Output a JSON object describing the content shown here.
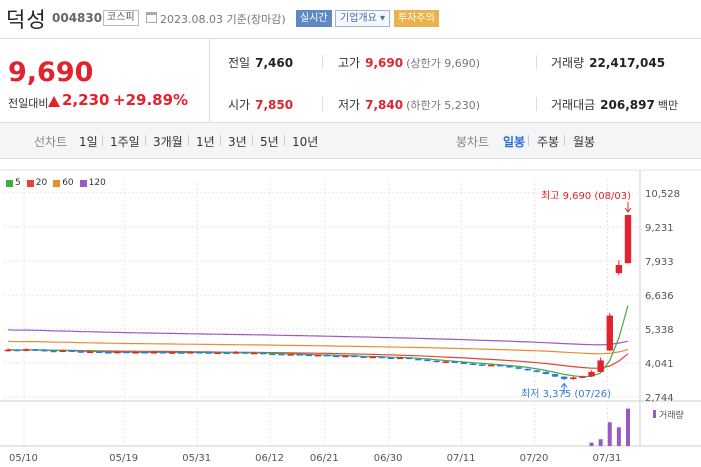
{
  "header": {
    "name": "덕성",
    "code": "004830",
    "market": "코스피",
    "date_text": "2023.08.03 기준(장마감)",
    "btn_realtime": "실시간",
    "btn_company": "기업개요",
    "btn_warning": "투자주의"
  },
  "quote": {
    "price": "9,690",
    "change_label": "전일대비",
    "change_value": "2,230",
    "change_percent": "+29.89%",
    "prev_close_label": "전일",
    "prev_close": "7,460",
    "open_label": "시가",
    "open": "7,850",
    "high_label": "고가",
    "high": "9,690",
    "upper_limit_text": "(상한가 9,690)",
    "low_label": "저가",
    "low": "7,840",
    "lower_limit_text": "(하한가 5,230)",
    "volume_label": "거래량",
    "volume": "22,417,045",
    "amount_label": "거래대금",
    "amount": "206,897",
    "amount_unit": "백만"
  },
  "tabs": {
    "line_label": "선차트",
    "periods": [
      "1일",
      "1주일",
      "3개월",
      "1년",
      "3년",
      "5년",
      "10년"
    ],
    "candle_label": "봉차트",
    "candle_options": [
      "일봉",
      "주봉",
      "월봉"
    ],
    "active_candle": "일봉"
  },
  "legend": [
    {
      "label": "5",
      "color": "#3fae3f"
    },
    {
      "label": "20",
      "color": "#e2443a"
    },
    {
      "label": "60",
      "color": "#ef8a2b"
    },
    {
      "label": "120",
      "color": "#9b59c4"
    }
  ],
  "chart_data": {
    "type": "candlestick",
    "y_ticks": [
      "10,528",
      "9,231",
      "7,933",
      "6,636",
      "5,338",
      "4,041",
      "2,744"
    ],
    "ylim": [
      2744,
      10528
    ],
    "x_ticks": [
      "05/10",
      "05/19",
      "05/31",
      "06/12",
      "06/21",
      "06/30",
      "07/11",
      "07/20",
      "07/31"
    ],
    "high_annotation": "최고 9,690 (08/03)",
    "low_annotation": "최저 3,375 (07/26)",
    "volume_label": "거래량",
    "colors": {
      "up": "#e0232e",
      "down": "#2f7ce0",
      "grid": "#e6e6e6"
    },
    "candles": [
      [
        4510,
        4550,
        4600,
        4470
      ],
      [
        4550,
        4520,
        4580,
        4480
      ],
      [
        4520,
        4560,
        4610,
        4490
      ],
      [
        4560,
        4540,
        4590,
        4500
      ],
      [
        4540,
        4510,
        4570,
        4480
      ],
      [
        4510,
        4480,
        4550,
        4450
      ],
      [
        4480,
        4520,
        4560,
        4460
      ],
      [
        4520,
        4490,
        4540,
        4460
      ],
      [
        4490,
        4450,
        4510,
        4420
      ],
      [
        4450,
        4480,
        4520,
        4430
      ],
      [
        4480,
        4460,
        4500,
        4430
      ],
      [
        4460,
        4430,
        4480,
        4400
      ],
      [
        4430,
        4470,
        4500,
        4410
      ],
      [
        4470,
        4440,
        4490,
        4420
      ],
      [
        4440,
        4460,
        4490,
        4420
      ],
      [
        4460,
        4430,
        4480,
        4410
      ],
      [
        4430,
        4460,
        4500,
        4410
      ],
      [
        4460,
        4440,
        4480,
        4420
      ],
      [
        4440,
        4450,
        4480,
        4420
      ],
      [
        4450,
        4420,
        4470,
        4400
      ],
      [
        4420,
        4460,
        4490,
        4400
      ],
      [
        4460,
        4450,
        4490,
        4430
      ],
      [
        4450,
        4420,
        4470,
        4400
      ],
      [
        4420,
        4440,
        4470,
        4400
      ],
      [
        4440,
        4430,
        4460,
        4410
      ],
      [
        4430,
        4450,
        4500,
        4410
      ],
      [
        4450,
        4420,
        4470,
        4400
      ],
      [
        4420,
        4430,
        4460,
        4400
      ],
      [
        4430,
        4400,
        4450,
        4380
      ],
      [
        4400,
        4390,
        4420,
        4370
      ],
      [
        4390,
        4360,
        4410,
        4340
      ],
      [
        4360,
        4380,
        4400,
        4340
      ],
      [
        4380,
        4360,
        4400,
        4340
      ],
      [
        4360,
        4330,
        4380,
        4310
      ],
      [
        4330,
        4350,
        4380,
        4310
      ],
      [
        4350,
        4320,
        4370,
        4300
      ],
      [
        4320,
        4300,
        4340,
        4280
      ],
      [
        4300,
        4320,
        4350,
        4280
      ],
      [
        4320,
        4290,
        4340,
        4270
      ],
      [
        4290,
        4260,
        4310,
        4240
      ],
      [
        4260,
        4280,
        4310,
        4240
      ],
      [
        4280,
        4250,
        4300,
        4230
      ],
      [
        4250,
        4230,
        4270,
        4210
      ],
      [
        4230,
        4250,
        4280,
        4210
      ],
      [
        4250,
        4200,
        4260,
        4180
      ],
      [
        4200,
        4170,
        4220,
        4150
      ],
      [
        4170,
        4130,
        4190,
        4110
      ],
      [
        4130,
        4090,
        4150,
        4070
      ],
      [
        4090,
        4100,
        4130,
        4060
      ],
      [
        4100,
        4060,
        4120,
        4040
      ],
      [
        4060,
        4020,
        4080,
        4000
      ],
      [
        4020,
        3990,
        4040,
        3970
      ],
      [
        3990,
        3960,
        4010,
        3940
      ],
      [
        3960,
        3970,
        4000,
        3930
      ],
      [
        3970,
        3930,
        3990,
        3910
      ],
      [
        3930,
        3880,
        3950,
        3860
      ],
      [
        3880,
        3820,
        3900,
        3800
      ],
      [
        3820,
        3760,
        3840,
        3740
      ],
      [
        3760,
        3700,
        3780,
        3680
      ],
      [
        3700,
        3620,
        3720,
        3600
      ],
      [
        3620,
        3520,
        3640,
        3500
      ],
      [
        3520,
        3430,
        3540,
        3375
      ],
      [
        3430,
        3490,
        3520,
        3400
      ],
      [
        3490,
        3530,
        3560,
        3460
      ],
      [
        3530,
        3700,
        3760,
        3510
      ],
      [
        3700,
        4140,
        4250,
        3690
      ],
      [
        4520,
        5850,
        5950,
        4500
      ],
      [
        7470,
        7780,
        7960,
        7400
      ],
      [
        7850,
        9690,
        9690,
        7840
      ]
    ],
    "volumes": [
      0,
      0,
      0,
      0,
      0,
      0,
      0,
      0,
      0,
      0,
      0,
      0,
      0,
      0,
      0,
      0,
      0,
      0,
      0,
      0,
      0,
      0,
      0,
      0,
      0,
      0,
      0,
      0,
      0,
      0,
      0,
      0,
      0,
      0,
      0,
      0,
      0,
      0,
      0,
      0,
      0,
      0,
      0,
      0,
      0,
      0,
      0,
      0,
      0,
      0,
      0,
      0,
      0,
      0,
      0,
      0,
      0,
      0,
      0,
      0,
      0,
      0,
      0,
      0,
      2,
      4,
      14,
      11,
      22
    ]
  }
}
